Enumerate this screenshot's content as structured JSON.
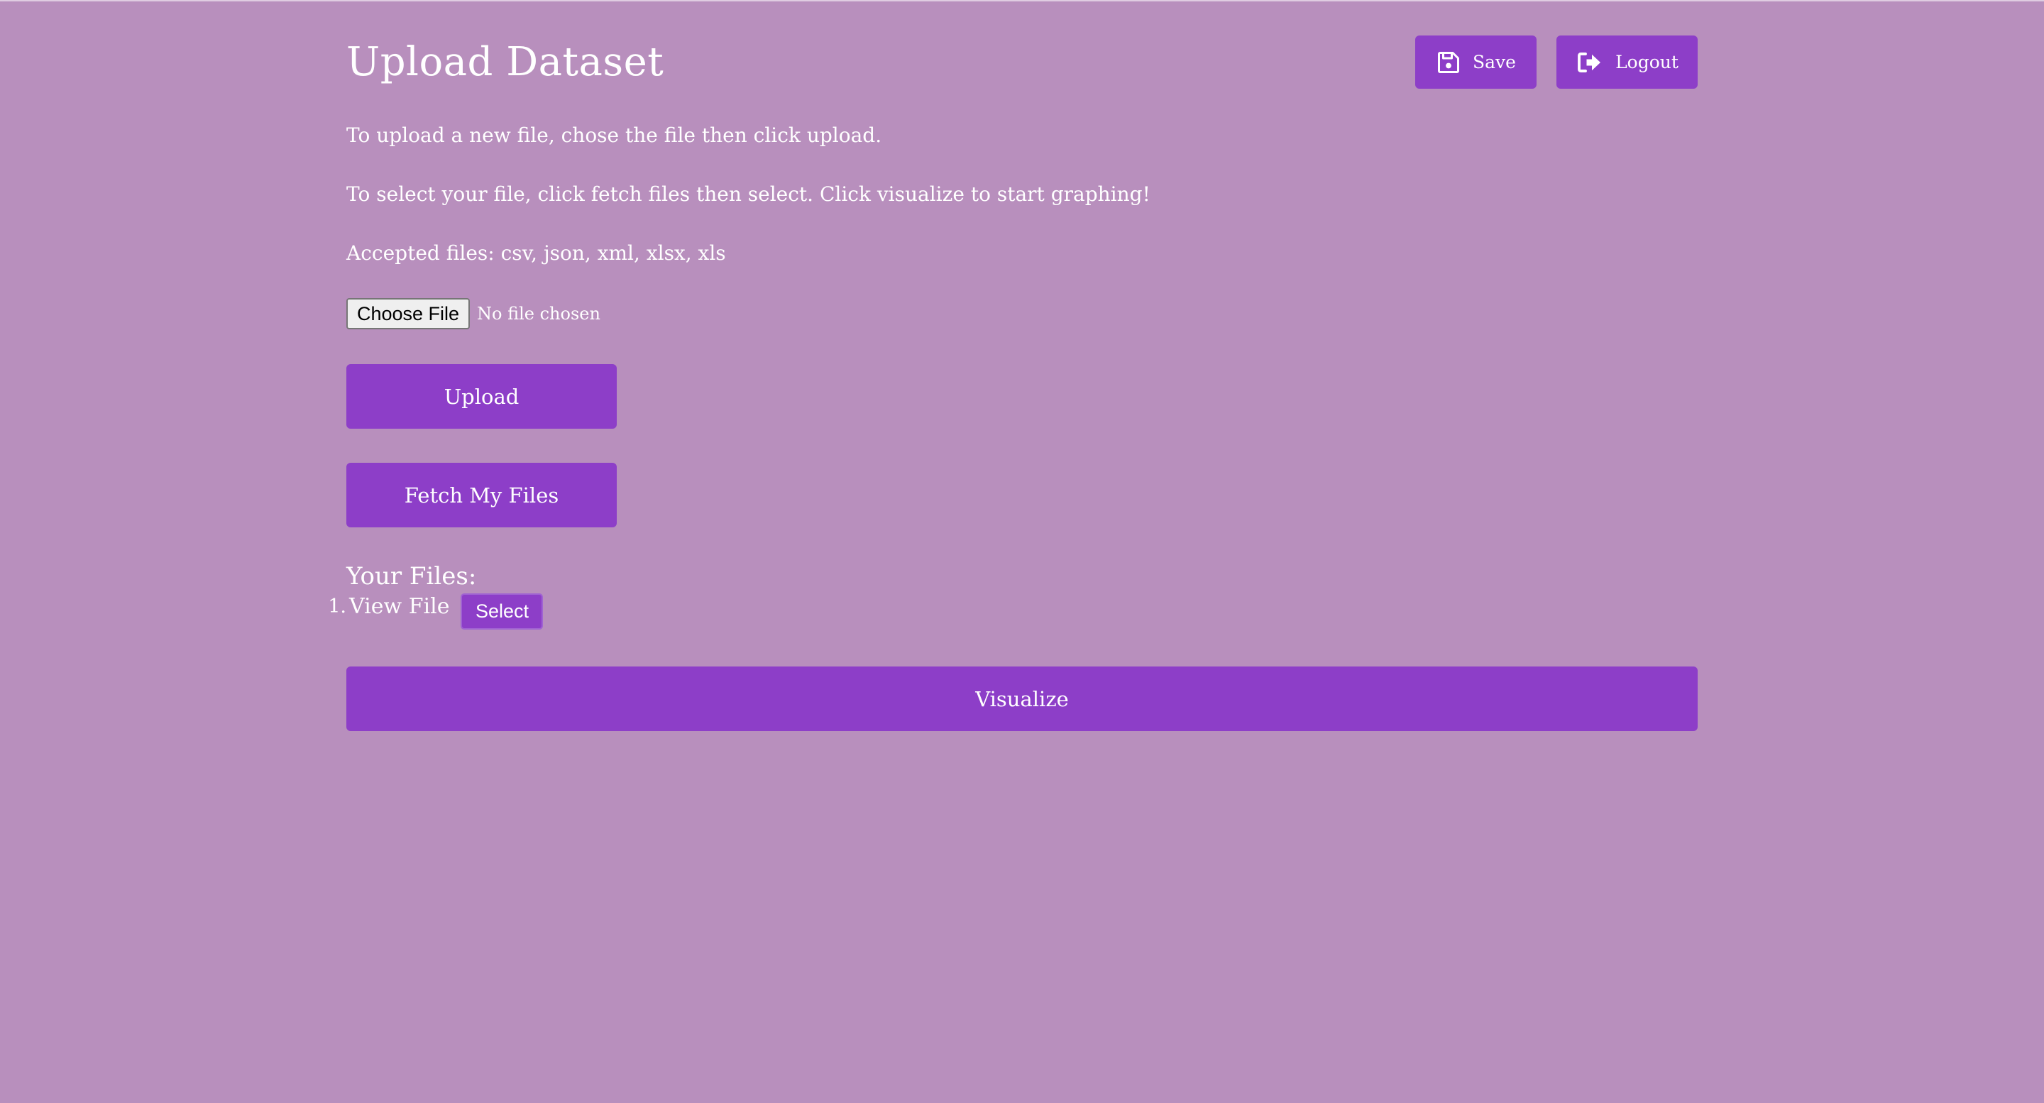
{
  "page": {
    "title": "Upload Dataset",
    "background_color": "#b88fbd",
    "accent_color": "#8d3ec8"
  },
  "header": {
    "save_label": "Save",
    "save_icon": "floppy-disk-icon",
    "logout_label": "Logout",
    "logout_icon": "sign-out-icon"
  },
  "instructions": {
    "line1": "To upload a new file, chose the file then click upload.",
    "line2": "To select your file, click fetch files then select. Click visualize to start graphing!",
    "line3": "Accepted files: csv, json, xml, xlsx, xls"
  },
  "file_input": {
    "button_label": "Choose File",
    "status": "No file chosen"
  },
  "actions": {
    "upload_label": "Upload",
    "fetch_label": "Fetch My Files",
    "visualize_label": "Visualize"
  },
  "files": {
    "heading": "Your Files:",
    "items": [
      {
        "number": "1.",
        "link_label": "View File",
        "select_label": "Select"
      }
    ]
  }
}
